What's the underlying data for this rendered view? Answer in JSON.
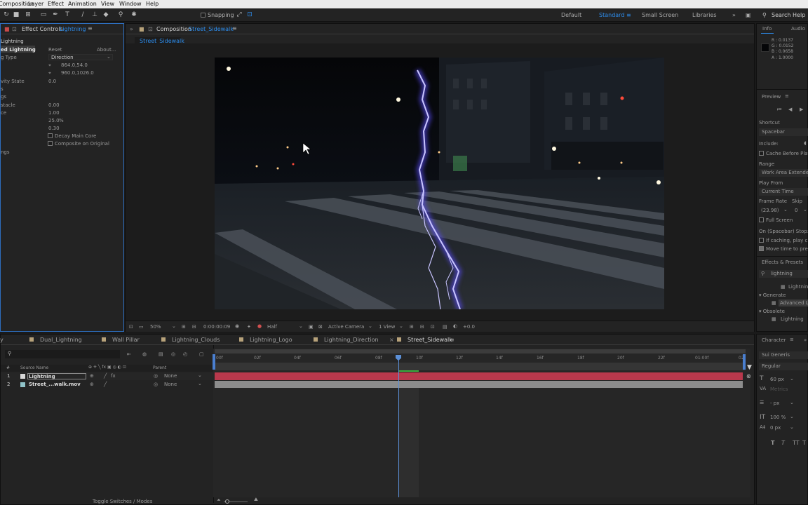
{
  "menu": [
    "Composition",
    "Layer",
    "Effect",
    "Animation",
    "View",
    "Window",
    "Help"
  ],
  "toolbar": {
    "snapping": "Snapping",
    "workspaces": [
      "Default",
      "Standard",
      "Small Screen",
      "Libraries"
    ],
    "search_help": "Search Help"
  },
  "effect_controls": {
    "tab_prefix": "Effect Controls",
    "tab_layer": "Lightning",
    "breadcrumb": "Lightning",
    "effect_name": "ed Lightning",
    "reset": "Reset",
    "about": "About...",
    "rows": {
      "type_label": "g Type",
      "type_value": "Direction",
      "origin_value": "864.0,54.0",
      "direction_value": "960.0,1026.0",
      "gravity_label": "vity State",
      "gravity_value": "0.0",
      "s_label": "s",
      "gs_label": "gs",
      "obstacle_label": "stacle",
      "obstacle_value": "0.00",
      "ce_label": "ce",
      "ce_value": "1.00",
      "pct_value": "25.0",
      "pct_unit": "%",
      "last_value": "0.30",
      "decay": "Decay Main Core",
      "composite": "Composite on Original",
      "ngs_label": "ngs"
    }
  },
  "composition": {
    "tab_prefix": "Composition",
    "tab_name": "Street_Sidewalk",
    "sub_tab": "Street_Sidewalk",
    "footer": {
      "zoom": "50%",
      "timecode": "0:00:00:09",
      "resolution": "Half",
      "camera": "Active Camera",
      "views": "1 View",
      "exposure": "+0.0"
    }
  },
  "timeline": {
    "tabs": [
      "Dual_Lightning",
      "Wall Pillar",
      "Lightning_Clouds",
      "Lightning_Logo",
      "Lightning_Direction",
      "Street_Sidewalk"
    ],
    "first_tab_fragment": "y",
    "columns": {
      "num": "#",
      "source": "Source Name",
      "parent": "Parent"
    },
    "layers": [
      {
        "num": "1",
        "name": "Lightning",
        "parent": "None",
        "color": "#c8c8c8"
      },
      {
        "num": "2",
        "name": "Street_...walk.mov",
        "parent": "None",
        "color": "#8fc2c8"
      }
    ],
    "ruler": [
      "00f",
      "02f",
      "04f",
      "06f",
      "08f",
      "10f",
      "12f",
      "14f",
      "16f",
      "18f",
      "20f",
      "22f",
      "01:00f",
      "02f"
    ],
    "playhead_frame": 9,
    "toggle": "Toggle Switches / Modes"
  },
  "info": {
    "tabs": [
      "Info",
      "Audio"
    ],
    "values": [
      "R : 0.0137",
      "G : 0.0152",
      "B : 0.0658",
      "A : 1.0000"
    ]
  },
  "preview": {
    "title": "Preview",
    "shortcut_label": "Shortcut",
    "shortcut_value": "Spacebar",
    "include_label": "Include:",
    "cache": "Cache Before Play",
    "range_label": "Range",
    "range_value": "Work Area Extended",
    "play_from_label": "Play From",
    "play_from_value": "Current Time",
    "frame_rate_label": "Frame Rate",
    "skip_label": "Skip",
    "frame_rate_value": "(23.98)",
    "skip_value": "0",
    "full_screen": "Full Screen",
    "on_stop": "On (Spacebar) Stop:",
    "if_caching": "If caching, play c",
    "move_time": "Move time to pre"
  },
  "effects_presets": {
    "title": "Effects & Presets",
    "search": "lightning",
    "top_item": "Lightnin",
    "generate": "Generate",
    "advanced": "Advanced L",
    "obsolete": "Obsolete",
    "obsolete_item": "Lightning"
  },
  "character": {
    "title": "Character",
    "font": "Sui Generis",
    "style": "Regular",
    "size": "60 px",
    "tracking_unit": "Metrics",
    "leading": "- px",
    "scale": "100 %",
    "baseline": "0 px"
  },
  "colors": {
    "accent": "#2d8ceb",
    "layer1_bar": "#b8384c",
    "layer2_bar": "#8c8c8c",
    "playhead": "#5b8fd6"
  }
}
